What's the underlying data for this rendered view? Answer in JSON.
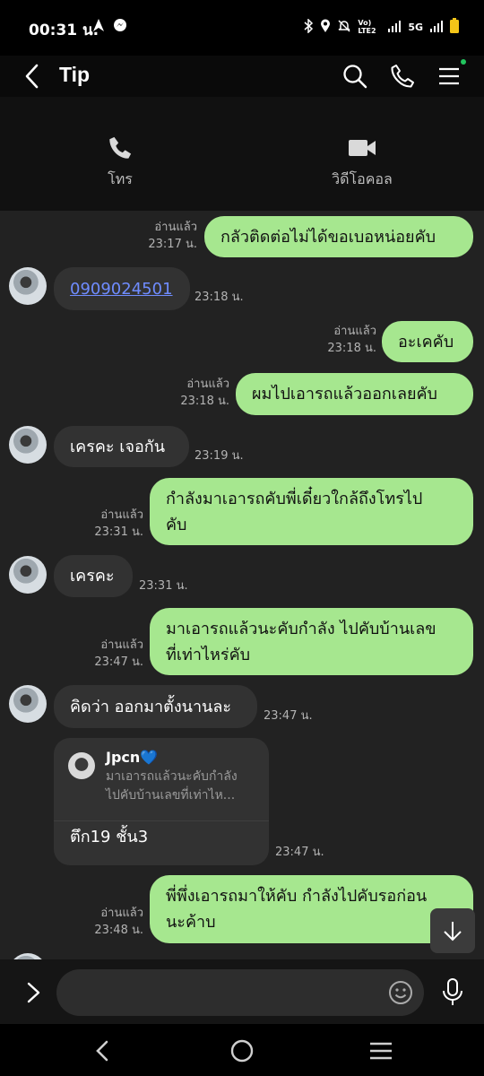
{
  "status_bar": {
    "time": "00:31 น.",
    "network": "5G",
    "volte": "Vo) LTE2"
  },
  "header": {
    "title": "Tip",
    "online_color": "#22c55e"
  },
  "quick_actions": {
    "call_label": "โทร",
    "video_label": "วิดีโอคอล"
  },
  "messages": [
    {
      "dir": "out",
      "text": "กลัวติดต่อไม่ได้ขอเบอหน่อยคับ",
      "read": "อ่านแล้ว",
      "time": "23:17 น."
    },
    {
      "dir": "in",
      "text": "0909024501",
      "time": "23:18 น.",
      "is_link": true
    },
    {
      "dir": "out",
      "text": "อะเคคับ",
      "read": "อ่านแล้ว",
      "time": "23:18 น."
    },
    {
      "dir": "out",
      "text": "ผมไปเอารถแล้วออกเลยคับ",
      "read": "อ่านแล้ว",
      "time": "23:18 น."
    },
    {
      "dir": "in",
      "text": "เครคะ เจอกัน",
      "time": "23:19 น."
    },
    {
      "dir": "out",
      "text": "กำลังมาเอารถคับพี่เดี๋ยวใกล้ถึงโทรไป\nคับ",
      "read": "อ่านแล้ว",
      "time": "23:31 น."
    },
    {
      "dir": "in",
      "text": "เครคะ",
      "time": "23:31 น."
    },
    {
      "dir": "out",
      "text": "มาเอารถแล้วนะคับกำลัง ไปคับบ้านเลข\nที่เท่าไหร่คับ",
      "read": "อ่านแล้ว",
      "time": "23:47 น."
    },
    {
      "dir": "in",
      "text": "คิดว่า ออกมาตั้งนานละ",
      "time": "23:47 น."
    },
    {
      "dir": "in",
      "text": "ตึก19 ชั้น3",
      "time": "23:47 น.",
      "reply_to": {
        "name": "Jpcn💙",
        "quote": "มาเอารถแล้วนะคับกำลัง\nไปคับบ้านเลขที่เท่าไห..."
      }
    },
    {
      "dir": "out",
      "text": "พี่พึ่งเอารถมาให้คับ กำลังไปคับรอก่อน\nนะค้าบ",
      "read": "อ่านแล้ว",
      "time": "23:48 น."
    }
  ],
  "input": {
    "placeholder": ""
  },
  "colors": {
    "outgoing_bubble": "#a6e78f",
    "incoming_bubble": "#323232",
    "chat_bg": "#222222",
    "link": "#6f8cff"
  }
}
